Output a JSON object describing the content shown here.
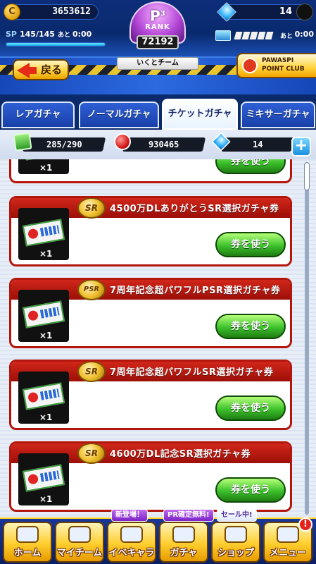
{
  "status": {
    "coins": "3653612",
    "coin_icon_glyph": "C",
    "sp_label": "SP",
    "sp_value": "145/145",
    "sp_ato": "あと",
    "sp_time": "0:00",
    "sp_fraction": 1.0,
    "gems": "14",
    "stamina_ato": "あと",
    "stamina_time": "0:00"
  },
  "rank": {
    "letter": "P",
    "superscript": "3",
    "word": "RANK",
    "score": "72192",
    "team": "いくとチーム"
  },
  "header": {
    "back_label": "戻る",
    "pawaspi_line1": "PAWASPI",
    "pawaspi_line2": "POINT CLUB"
  },
  "tabs": [
    {
      "label": "レアガチャ"
    },
    {
      "label": "ノーマルガチャ"
    },
    {
      "label": "チケットガチャ"
    },
    {
      "label": "ミキサーガチャ"
    }
  ],
  "currencies": {
    "boxes": "285/290",
    "balls": "930465",
    "gems": "14",
    "plus": "+"
  },
  "tickets": [
    {
      "badge": "",
      "title": "",
      "qty": "×1",
      "button": "券を使う"
    },
    {
      "badge": "SR",
      "title": "4500万DLありがとうSR選択ガチャ券",
      "qty": "×1",
      "button": "券を使う"
    },
    {
      "badge": "PSR",
      "title": "7周年記念超パワフルPSR選択ガチャ券",
      "qty": "×1",
      "button": "券を使う"
    },
    {
      "badge": "SR",
      "title": "7周年記念超パワフルSR選択ガチャ券",
      "qty": "×1",
      "button": "券を使う"
    },
    {
      "badge": "SR",
      "title": "4600万DL記念SR選択ガチャ券",
      "qty": "×1",
      "button": "券を使う"
    }
  ],
  "nav": [
    {
      "label": "ホーム",
      "icon": "home-icon"
    },
    {
      "label": "マイチーム",
      "icon": "team-icon"
    },
    {
      "label": "イベキャラ",
      "icon": "event-chara-icon"
    },
    {
      "label": "ガチャ",
      "icon": "gacha-icon"
    },
    {
      "label": "ショップ",
      "icon": "shop-icon"
    },
    {
      "label": "メニュー",
      "icon": "menu-icon"
    }
  ],
  "nav_tags": {
    "event": "新登場！",
    "gacha": "PR確定無料!",
    "shop": "セール中!",
    "menu_alert": "!"
  }
}
